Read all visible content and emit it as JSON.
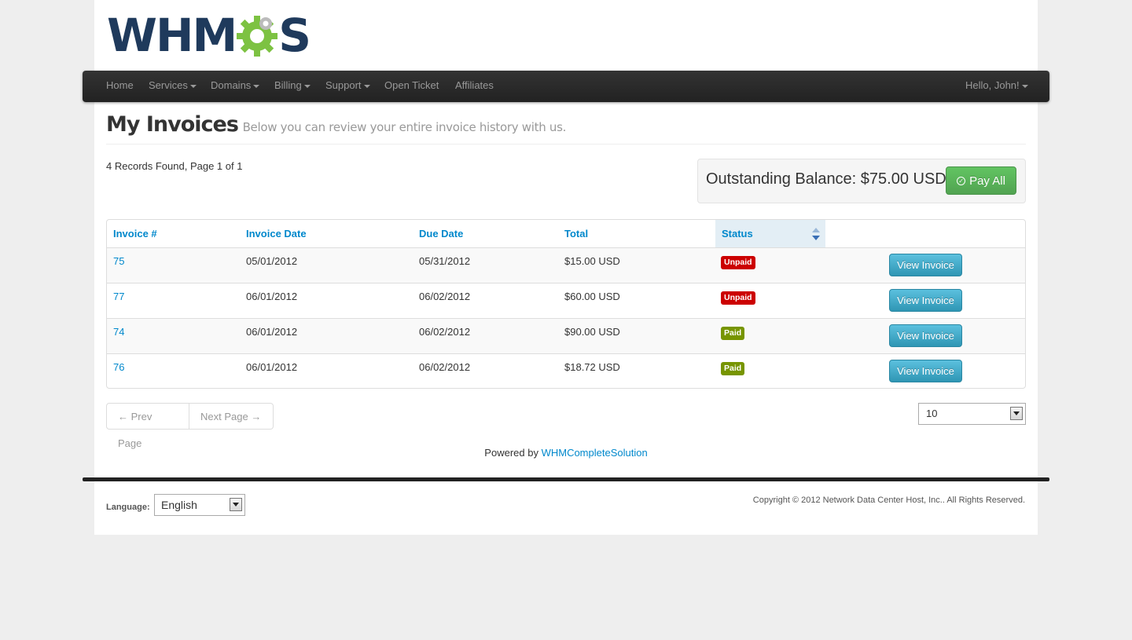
{
  "logo": {
    "text_left": "WHM",
    "text_right": "S",
    "gear_color": "#7dc242",
    "text_color": "#1f3a5c"
  },
  "nav": {
    "items": [
      {
        "label": "Home",
        "dropdown": false
      },
      {
        "label": "Services",
        "dropdown": true
      },
      {
        "label": "Domains",
        "dropdown": true
      },
      {
        "label": "Billing",
        "dropdown": true
      },
      {
        "label": "Support",
        "dropdown": true
      },
      {
        "label": "Open Ticket",
        "dropdown": false
      },
      {
        "label": "Affiliates",
        "dropdown": false
      }
    ],
    "user": {
      "label": "Hello, John!",
      "dropdown": true
    }
  },
  "page": {
    "title": "My Invoices",
    "subtitle": "Below you can review your entire invoice history with us.",
    "records_info": "4 Records Found, Page 1 of 1"
  },
  "balance": {
    "text": "Outstanding Balance: $75.00 USD",
    "pay_all_label": "Pay All"
  },
  "table": {
    "columns": [
      "Invoice #",
      "Invoice Date",
      "Due Date",
      "Total",
      "Status"
    ],
    "sorted_column": "Status",
    "rows": [
      {
        "invoice": "75",
        "invoice_date": "05/01/2012",
        "due_date": "05/31/2012",
        "total": "$15.00 USD",
        "status": "Unpaid",
        "action": "View Invoice"
      },
      {
        "invoice": "77",
        "invoice_date": "06/01/2012",
        "due_date": "06/02/2012",
        "total": "$60.00 USD",
        "status": "Unpaid",
        "action": "View Invoice"
      },
      {
        "invoice": "74",
        "invoice_date": "06/01/2012",
        "due_date": "06/02/2012",
        "total": "$90.00 USD",
        "status": "Paid",
        "action": "View Invoice"
      },
      {
        "invoice": "76",
        "invoice_date": "06/01/2012",
        "due_date": "06/02/2012",
        "total": "$18.72 USD",
        "status": "Paid",
        "action": "View Invoice"
      }
    ],
    "status_colors": {
      "Unpaid": "#cc0000",
      "Paid": "#779500"
    }
  },
  "pager": {
    "prev_label": "← Prev Page",
    "next_label": "Next Page →"
  },
  "per_page": {
    "value": "10"
  },
  "powered": {
    "prefix": "Powered by",
    "link": "WHMCompleteSolution"
  },
  "footer": {
    "language_label": "Language:",
    "language_value": "English",
    "copyright": "Copyright © 2012 Network Data Center Host, Inc.. All Rights Reserved."
  }
}
